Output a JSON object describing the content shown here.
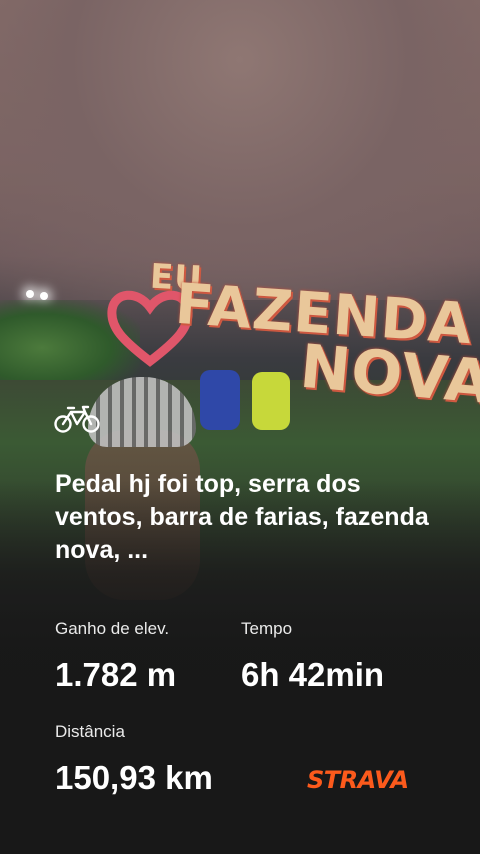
{
  "activity": {
    "icon": "bike-icon",
    "title": "Pedal hj foi top, serra dos ventos, barra de farias, fazenda nova, ..."
  },
  "background_sign": {
    "line1": "EU",
    "line2": "FAZENDA",
    "line3": "NOVA"
  },
  "stats": {
    "elevation_label": "Ganho de elev.",
    "elevation_value": "1.782 m",
    "time_label": "Tempo",
    "time_value": "6h 42min",
    "distance_label": "Distância",
    "distance_value": "150,93 km"
  },
  "brand": {
    "name": "STRAVA",
    "color": "#fc5a1c"
  }
}
